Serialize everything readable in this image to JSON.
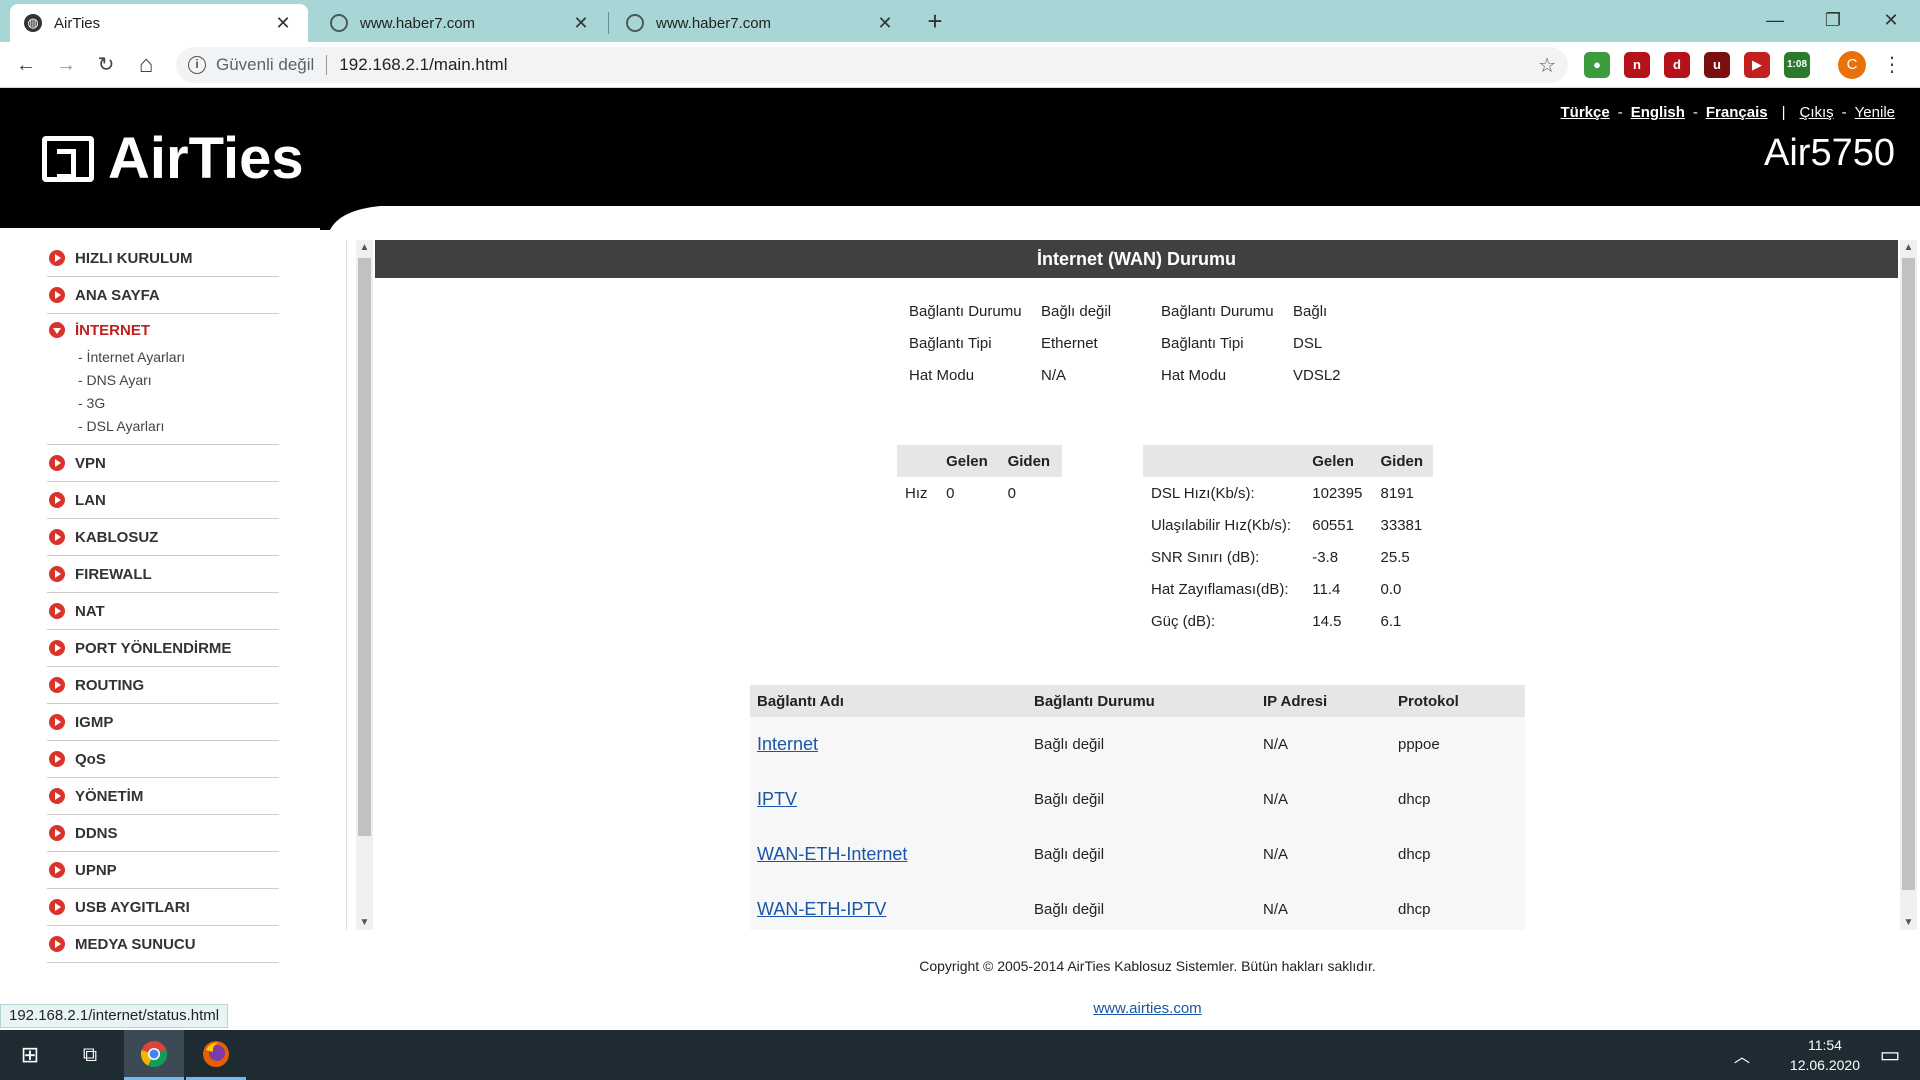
{
  "browser": {
    "tabs": [
      {
        "title": "AirTies",
        "active": true
      },
      {
        "title": "www.haber7.com",
        "active": false
      },
      {
        "title": "www.haber7.com",
        "active": false
      }
    ],
    "new_tab": "+",
    "window_controls": {
      "minimize": "—",
      "maximize": "❐",
      "close": "✕"
    },
    "nav": {
      "back": "←",
      "forward": "→",
      "reload": "↻",
      "home": "⌂"
    },
    "omnibox": {
      "security_label": "Güvenli değil",
      "url": "192.168.2.1/main.html",
      "info_icon": "i",
      "star_icon": "☆"
    },
    "extensions": [
      {
        "icon": "globe-icon",
        "label": "●",
        "color": "#3c9b3c"
      },
      {
        "icon": "n-icon",
        "label": "n",
        "color": "#b6121b"
      },
      {
        "icon": "d-icon",
        "label": "d",
        "color": "#b6121b"
      },
      {
        "icon": "ublock-icon",
        "label": "u",
        "color": "#7a0f0f"
      },
      {
        "icon": "play-icon",
        "label": "▶",
        "color": "#c21f1f"
      },
      {
        "icon": "battery-icon",
        "label": "1:08",
        "color": "#2b7a2b"
      }
    ],
    "profile_initial": "C",
    "menu": "⋮",
    "status_url": "192.168.2.1/internet/status.html"
  },
  "header": {
    "brand": "AirTies",
    "model": "Air5750",
    "languages": [
      "Türkçe",
      "English",
      "Français"
    ],
    "lang_sep": "-",
    "bar_sep": "|",
    "logout": "Çıkış",
    "refresh": "Yenile"
  },
  "sidebar": {
    "items": [
      {
        "label": "HIZLI KURULUM"
      },
      {
        "label": "ANA SAYFA"
      },
      {
        "label": "İNTERNET",
        "open": true,
        "sub": [
          "- İnternet Ayarları",
          "- DNS Ayarı",
          "- 3G",
          "- DSL Ayarları"
        ]
      },
      {
        "label": "VPN"
      },
      {
        "label": "LAN"
      },
      {
        "label": "KABLOSUZ"
      },
      {
        "label": "FIREWALL"
      },
      {
        "label": "NAT"
      },
      {
        "label": "PORT YÖNLENDİRME"
      },
      {
        "label": "ROUTING"
      },
      {
        "label": "IGMP"
      },
      {
        "label": "QoS"
      },
      {
        "label": "YÖNETİM"
      },
      {
        "label": "DDNS"
      },
      {
        "label": "UPNP"
      },
      {
        "label": "USB AYGITLARI"
      },
      {
        "label": "MEDYA SUNUCU"
      }
    ]
  },
  "main": {
    "title": "İnternet (WAN) Durumu",
    "status_left": [
      {
        "key": "Bağlantı Durumu",
        "value": "Bağlı değil"
      },
      {
        "key": "Bağlantı Tipi",
        "value": "Ethernet"
      },
      {
        "key": "Hat Modu",
        "value": "N/A"
      }
    ],
    "status_right": [
      {
        "key": "Bağlantı Durumu",
        "value": "Bağlı"
      },
      {
        "key": "Bağlantı Tipi",
        "value": "DSL"
      },
      {
        "key": "Hat Modu",
        "value": "VDSL2"
      }
    ],
    "speed_table": {
      "headers": [
        "",
        "Gelen",
        "Giden"
      ],
      "rows": [
        [
          "Hız",
          "0",
          "0"
        ]
      ]
    },
    "dsl_table": {
      "headers": [
        "",
        "Gelen",
        "Giden"
      ],
      "rows": [
        [
          "DSL Hızı(Kb/s):",
          "102395",
          "8191"
        ],
        [
          "Ulaşılabilir Hız(Kb/s):",
          "60551",
          "33381"
        ],
        [
          "SNR Sınırı (dB):",
          "-3.8",
          "25.5"
        ],
        [
          "Hat Zayıflaması(dB):",
          "11.4",
          "0.0"
        ],
        [
          "Güç (dB):",
          "14.5",
          "6.1"
        ]
      ]
    },
    "connections": {
      "headers": [
        "Bağlantı Adı",
        "Bağlantı Durumu",
        "IP Adresi",
        "Protokol"
      ],
      "rows": [
        [
          "Internet",
          "Bağlı değil",
          "N/A",
          "pppoe"
        ],
        [
          "IPTV",
          "Bağlı değil",
          "N/A",
          "dhcp"
        ],
        [
          "WAN-ETH-Internet",
          "Bağlı değil",
          "N/A",
          "dhcp"
        ],
        [
          "WAN-ETH-IPTV",
          "Bağlı değil",
          "N/A",
          "dhcp"
        ]
      ]
    }
  },
  "footer": {
    "copyright": "Copyright © 2005-2014 AirTies Kablosuz Sistemler. Bütün hakları saklıdır.",
    "link": "www.airties.com"
  },
  "taskbar": {
    "time": "11:54",
    "date": "12.06.2020",
    "start_icon": "⊞",
    "taskview_icon": "⧉",
    "tray_chevron": "︿",
    "notify_icon": "▭"
  }
}
